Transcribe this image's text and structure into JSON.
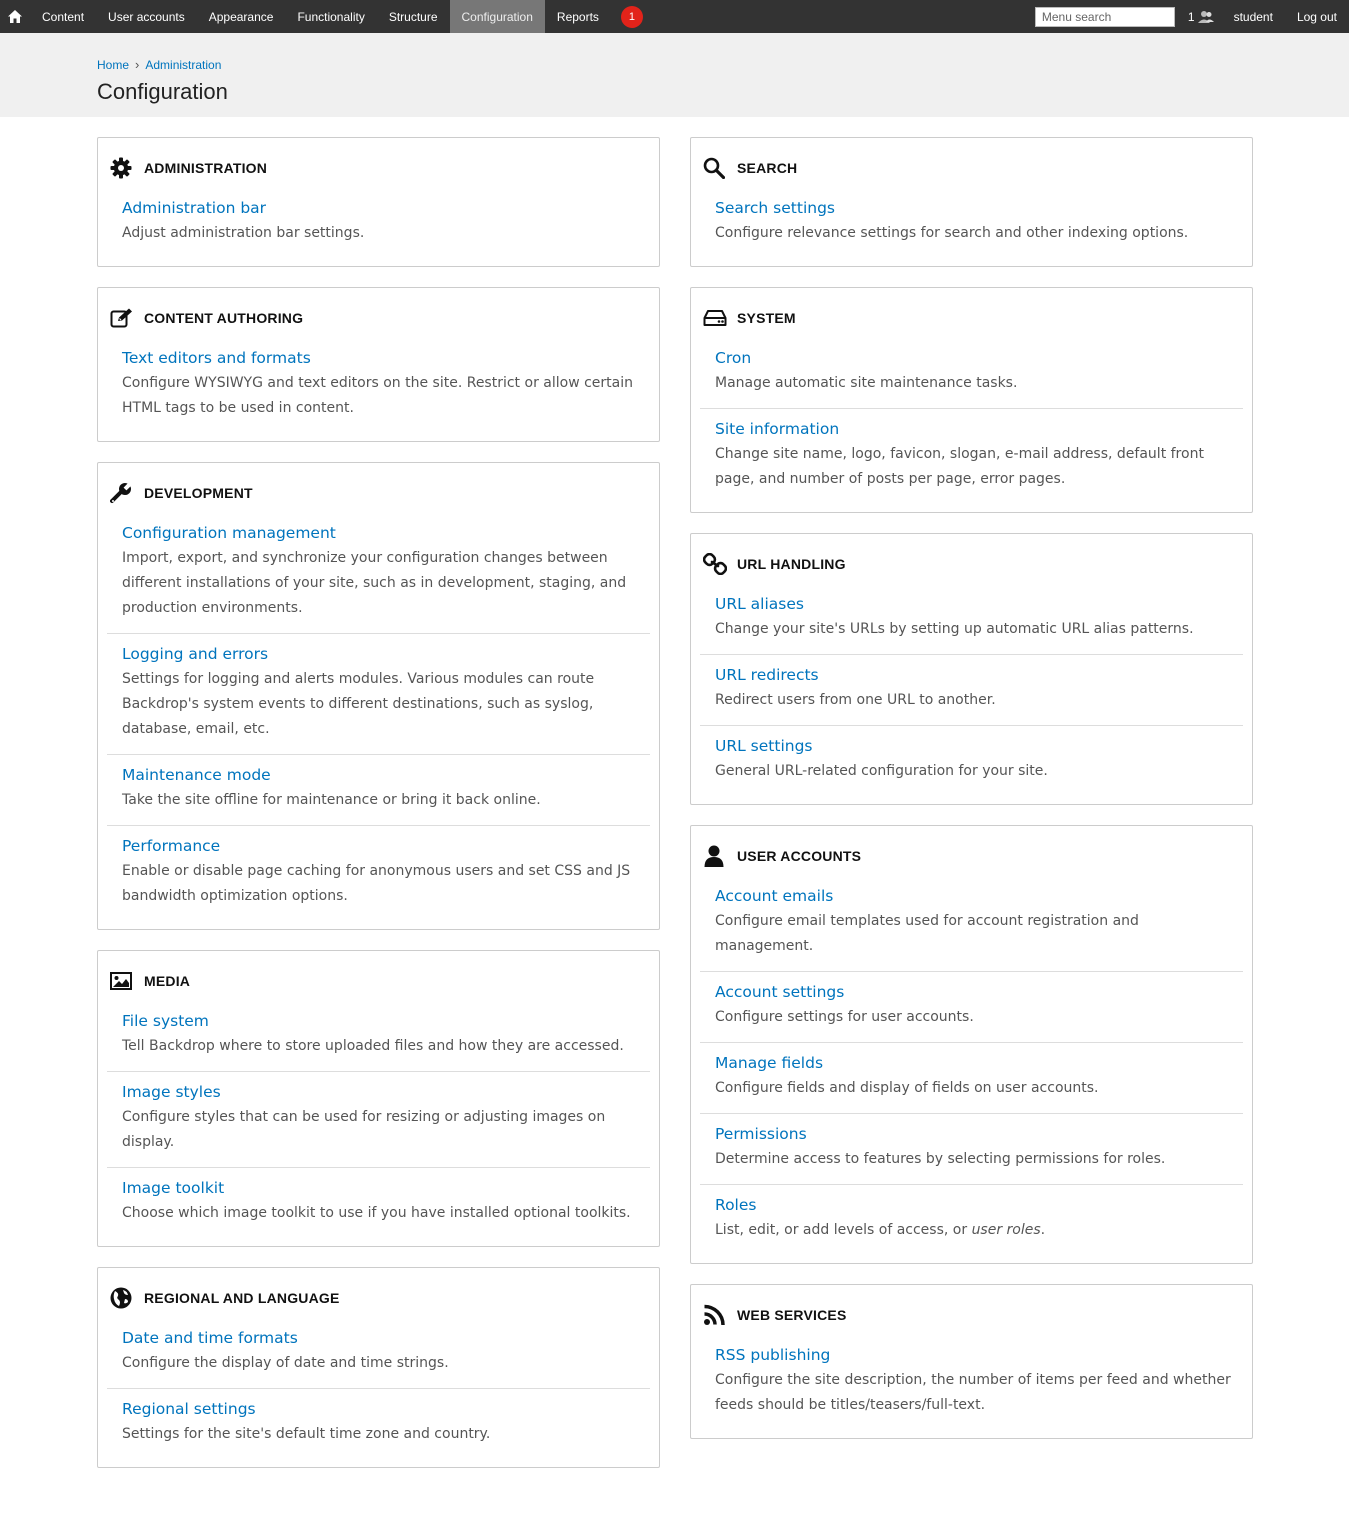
{
  "admin_bar": {
    "nav": [
      "Content",
      "User accounts",
      "Appearance",
      "Functionality",
      "Structure",
      "Configuration",
      "Reports"
    ],
    "active": "Configuration",
    "badge_count": "1",
    "search_placeholder": "Menu search",
    "users_count": "1",
    "username": "student",
    "logout": "Log out"
  },
  "breadcrumb": {
    "home": "Home",
    "administration": "Administration",
    "separator": "›"
  },
  "page_title": "Configuration",
  "left_panels": [
    {
      "icon": "gear-icon",
      "title": "Administration",
      "items": [
        {
          "link": "Administration bar",
          "desc": "Adjust administration bar settings."
        }
      ]
    },
    {
      "icon": "edit-icon",
      "title": "Content authoring",
      "items": [
        {
          "link": "Text editors and formats",
          "desc": "Configure WYSIWYG and text editors on the site. Restrict or allow certain HTML tags to be used in content."
        }
      ]
    },
    {
      "icon": "wrench-icon",
      "title": "Development",
      "items": [
        {
          "link": "Configuration management",
          "desc": "Import, export, and synchronize your configuration changes between different installations of your site, such as in development, staging, and production environments."
        },
        {
          "link": "Logging and errors",
          "desc": "Settings for logging and alerts modules. Various modules can route Backdrop's system events to different destinations, such as syslog, database, email, etc."
        },
        {
          "link": "Maintenance mode",
          "desc": "Take the site offline for maintenance or bring it back online."
        },
        {
          "link": "Performance",
          "desc": "Enable or disable page caching for anonymous users and set CSS and JS bandwidth optimization options."
        }
      ]
    },
    {
      "icon": "image-icon",
      "title": "Media",
      "items": [
        {
          "link": "File system",
          "desc": "Tell Backdrop where to store uploaded files and how they are accessed."
        },
        {
          "link": "Image styles",
          "desc": "Configure styles that can be used for resizing or adjusting images on display."
        },
        {
          "link": "Image toolkit",
          "desc": "Choose which image toolkit to use if you have installed optional toolkits."
        }
      ]
    },
    {
      "icon": "globe-icon",
      "title": "Regional and language",
      "items": [
        {
          "link": "Date and time formats",
          "desc": "Configure the display of date and time strings."
        },
        {
          "link": "Regional settings",
          "desc": "Settings for the site's default time zone and country."
        }
      ]
    }
  ],
  "right_panels": [
    {
      "icon": "search-icon",
      "title": "Search",
      "items": [
        {
          "link": "Search settings",
          "desc": "Configure relevance settings for search and other indexing options."
        }
      ]
    },
    {
      "icon": "hard-drive-icon",
      "title": "System",
      "items": [
        {
          "link": "Cron",
          "desc": "Manage automatic site maintenance tasks."
        },
        {
          "link": "Site information",
          "desc": "Change site name, logo, favicon, slogan, e-mail address, default front page, and number of posts per page, error pages."
        }
      ]
    },
    {
      "icon": "link-icon",
      "title": "URL handling",
      "items": [
        {
          "link": "URL aliases",
          "desc": "Change your site's URLs by setting up automatic URL alias patterns."
        },
        {
          "link": "URL redirects",
          "desc": "Redirect users from one URL to another."
        },
        {
          "link": "URL settings",
          "desc": "General URL-related configuration for your site."
        }
      ]
    },
    {
      "icon": "user-icon",
      "title": "User accounts",
      "items": [
        {
          "link": "Account emails",
          "desc": "Configure email templates used for account registration and management."
        },
        {
          "link": "Account settings",
          "desc": "Configure settings for user accounts."
        },
        {
          "link": "Manage fields",
          "desc": "Configure fields and display of fields on user accounts."
        },
        {
          "link": "Permissions",
          "desc": "Determine access to features by selecting permissions for roles."
        },
        {
          "link": "Roles",
          "desc": "List, edit, or add levels of access, or ",
          "desc_em": "user roles",
          "desc_tail": "."
        }
      ]
    },
    {
      "icon": "rss-icon",
      "title": "Web services",
      "items": [
        {
          "link": "RSS publishing",
          "desc": "Configure the site description, the number of items per feed and whether feeds should be titles/teasers/full-text."
        }
      ]
    }
  ]
}
